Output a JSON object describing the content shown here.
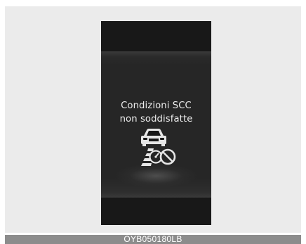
{
  "display": {
    "message_line1": "Condizioni SCC",
    "message_line2": "non soddisfatte",
    "icon": "scc-condition-not-met-icon"
  },
  "footer": {
    "code": "OYB050180LB"
  },
  "colors": {
    "panel_background": "#ebebeb",
    "display_background": "#181818",
    "display_text": "#ececec",
    "code_bar": "#8c8c8c"
  }
}
